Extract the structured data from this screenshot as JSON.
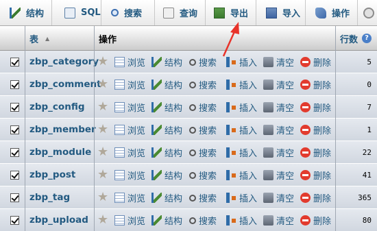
{
  "tabs": [
    {
      "label": "结构",
      "icon": "structure-icon",
      "highlight": false
    },
    {
      "label": "SQL",
      "icon": "sql-icon",
      "highlight": false
    },
    {
      "label": "搜索",
      "icon": "search-icon",
      "highlight": false
    },
    {
      "label": "查询",
      "icon": "query-icon",
      "highlight": false
    },
    {
      "label": "导出",
      "icon": "export-icon",
      "highlight": true
    },
    {
      "label": "导入",
      "icon": "import-icon",
      "highlight": false
    },
    {
      "label": "操作",
      "icon": "operations-icon",
      "highlight": false
    },
    {
      "label": "",
      "icon": "more-icon",
      "highlight": false
    }
  ],
  "header": {
    "table_col": "表",
    "sort_indicator": "▲",
    "ops_col": "操作",
    "rows_col": "行数",
    "help_icon": "?"
  },
  "actions": {
    "browse": "浏览",
    "structure": "结构",
    "search": "搜索",
    "insert": "插入",
    "empty": "清空",
    "drop": "删除"
  },
  "rows": [
    {
      "name": "zbp_category",
      "count": "5",
      "checked": true
    },
    {
      "name": "zbp_comment",
      "count": "0",
      "checked": true
    },
    {
      "name": "zbp_config",
      "count": "7",
      "checked": true
    },
    {
      "name": "zbp_member",
      "count": "1",
      "checked": true
    },
    {
      "name": "zbp_module",
      "count": "22",
      "checked": true
    },
    {
      "name": "zbp_post",
      "count": "41",
      "checked": true
    },
    {
      "name": "zbp_tag",
      "count": "365",
      "checked": true
    },
    {
      "name": "zbp_upload",
      "count": "80",
      "checked": true
    }
  ],
  "colors": {
    "link": "#235a81",
    "annotation_arrow": "#e8332a",
    "row_bg": "#d8dde5"
  }
}
